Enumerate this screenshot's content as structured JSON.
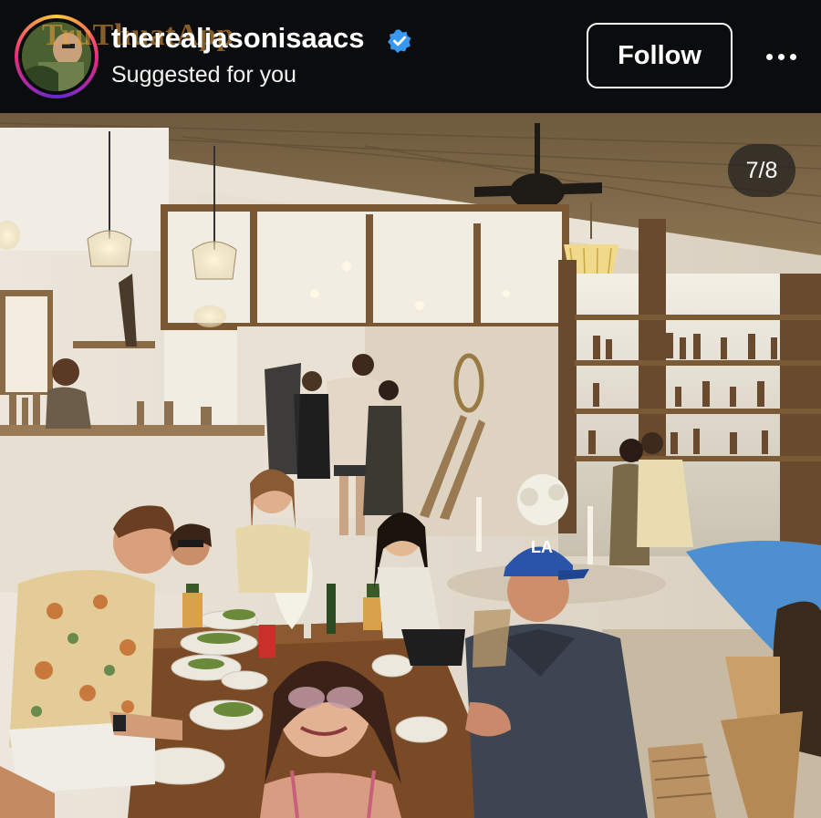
{
  "post": {
    "username": "therealjasonisaacs",
    "verified": true,
    "subtitle": "Suggested for you",
    "follow_label": "Follow",
    "more_icon": "more-horizontal-icon",
    "watermark": "TruThuatApp"
  },
  "carousel": {
    "counter": "7/8"
  },
  "photo": {
    "description_icon": "restaurant-group-photo",
    "cap_logo": "LA"
  },
  "colors": {
    "header_bg": "#0b0c0e",
    "verified_blue": "#3897f0",
    "text": "#ffffff"
  }
}
